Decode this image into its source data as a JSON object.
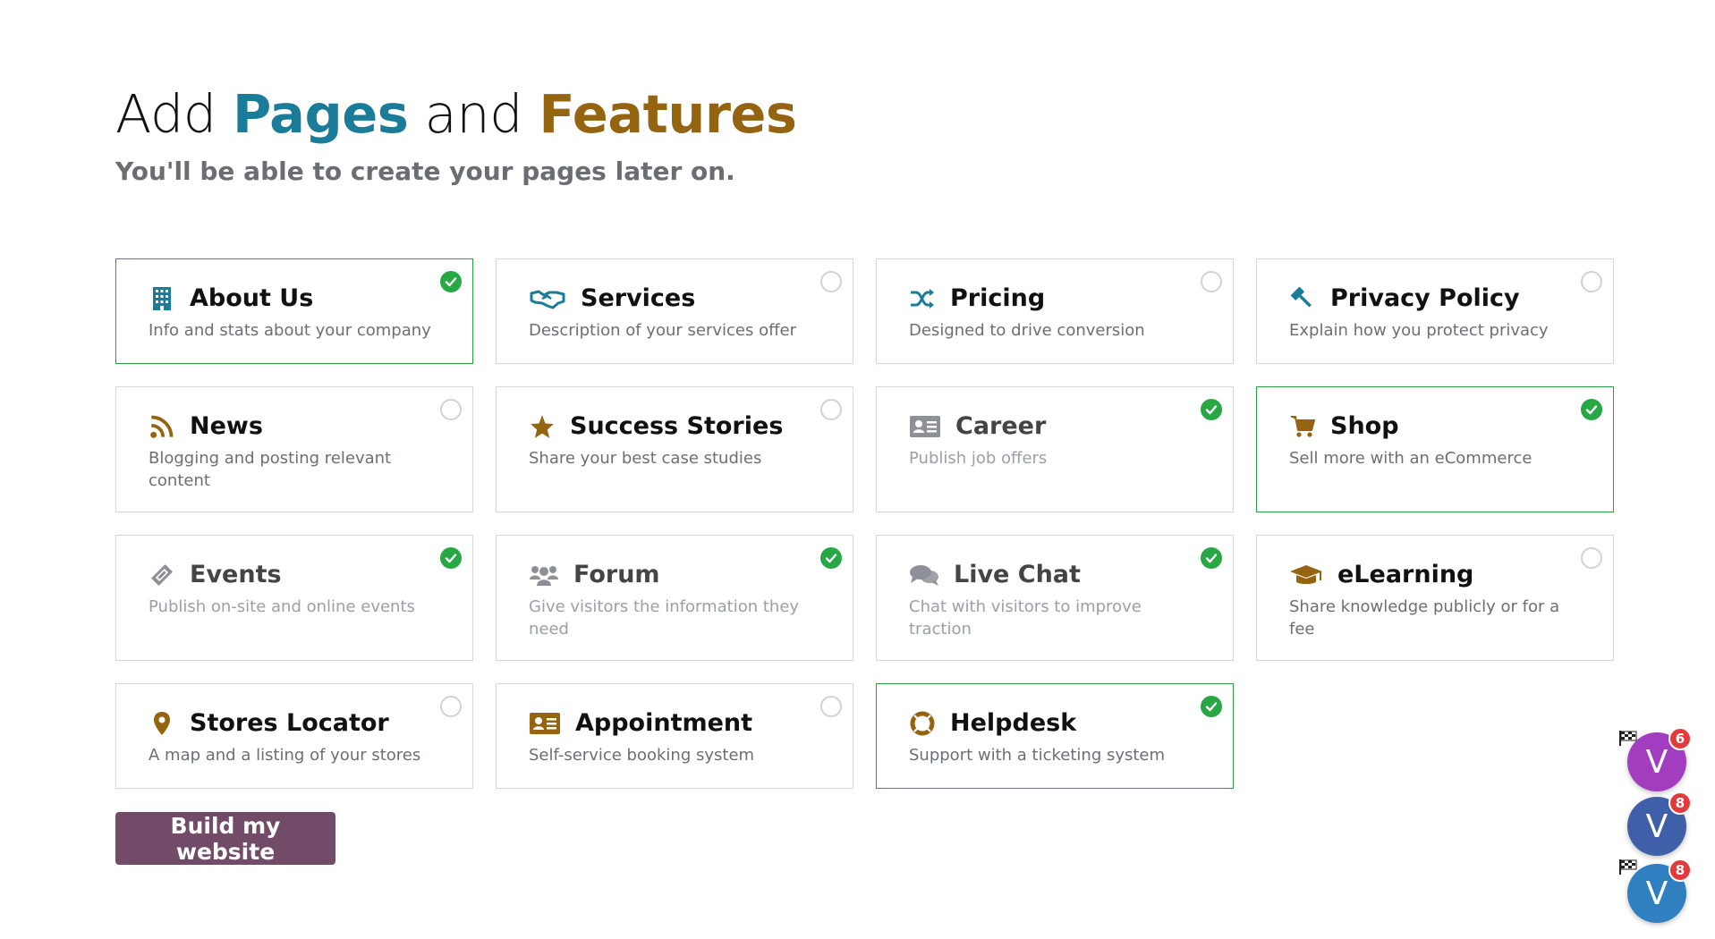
{
  "header": {
    "title_prefix": "Add",
    "title_pages": "Pages",
    "title_and": "and",
    "title_features": "Features",
    "subtitle": "You'll be able to create your pages later on."
  },
  "colors": {
    "pages_accent": "#1b7c9a",
    "features_accent": "#946411",
    "selected_border": "#2a9d48",
    "check_on": "#28a745",
    "button_bg": "#714b67"
  },
  "cards": [
    {
      "title": "About Us",
      "desc": "Info and stats about your company",
      "icon": "building-icon",
      "selected": true
    },
    {
      "title": "Services",
      "desc": "Description of your services offer",
      "icon": "handshake-icon",
      "selected": false
    },
    {
      "title": "Pricing",
      "desc": "Designed to drive conversion",
      "icon": "shuffle-icon",
      "selected": false
    },
    {
      "title": "Privacy Policy",
      "desc": "Explain how you protect privacy",
      "icon": "gavel-icon",
      "selected": false
    },
    {
      "title": "News",
      "desc": "Blogging and posting relevant content",
      "icon": "rss-icon",
      "selected": false
    },
    {
      "title": "Success Stories",
      "desc": "Share your best case studies",
      "icon": "star-icon",
      "selected": false
    },
    {
      "title": "Career",
      "desc": "Publish job offers",
      "icon": "id-card-icon",
      "selected": true
    },
    {
      "title": "Shop",
      "desc": "Sell more with an eCommerce",
      "icon": "cart-icon",
      "selected": true
    },
    {
      "title": "Events",
      "desc": "Publish on-site and online events",
      "icon": "ticket-icon",
      "selected": true
    },
    {
      "title": "Forum",
      "desc": "Give visitors the information they need",
      "icon": "users-icon",
      "selected": true
    },
    {
      "title": "Live Chat",
      "desc": "Chat with visitors to improve traction",
      "icon": "chat-icon",
      "selected": true
    },
    {
      "title": "eLearning",
      "desc": "Share knowledge publicly or for a fee",
      "icon": "graduation-cap-icon",
      "selected": false
    },
    {
      "title": "Stores Locator",
      "desc": "A map and a listing of your stores",
      "icon": "map-marker-icon",
      "selected": false
    },
    {
      "title": "Appointment",
      "desc": "Self-service booking system",
      "icon": "address-card-icon",
      "selected": false
    },
    {
      "title": "Helpdesk",
      "desc": "Support with a ticketing system",
      "icon": "life-ring-icon",
      "selected": true
    }
  ],
  "build_button": "Build my website",
  "chat_bubbles": [
    {
      "letter": "V",
      "count": "6",
      "color": "#a23dbf"
    },
    {
      "letter": "V",
      "count": "8",
      "color": "#3f5fa8"
    },
    {
      "letter": "V",
      "count": "8",
      "color": "#2f7fc1"
    }
  ]
}
